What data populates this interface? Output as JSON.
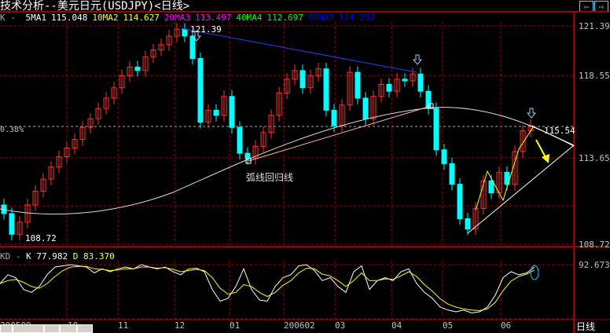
{
  "window": {
    "title": "技术分析--美元日元(USDJPY)<日线>",
    "nav_left_icon": "arrow-left-icon",
    "nav_right_icon": "arrow-right-icon"
  },
  "ma_row": {
    "prefix": "K -",
    "items": [
      {
        "label": "5MA1",
        "value": "115.048",
        "color": "#ffffff"
      },
      {
        "label": "10MA2",
        "value": "114.627",
        "color": "#ffff00"
      },
      {
        "label": "20MA3",
        "value": "113.497",
        "color": "#ff00ff"
      },
      {
        "label": "40MA4",
        "value": "112.697",
        "color": "#00ff00"
      },
      {
        "label": "60MA5",
        "value": "114.292",
        "color": "#0000ff"
      }
    ]
  },
  "price_axis": [
    "121.39",
    "118.55",
    "115.54",
    "113.65",
    "108.72"
  ],
  "left_readout": "0.38%",
  "annotations": {
    "high_label": "121.39",
    "low_label": "108.72",
    "last_label": "115.54",
    "curve_label": "弧线回归线"
  },
  "kd_row": {
    "prefix": "KD -",
    "k_label": "K",
    "k_value": "77.982",
    "d_label": "D",
    "d_value": "83.370",
    "axis_value": "92.673"
  },
  "x_axis": {
    "labels": [
      "200509",
      "10",
      "11",
      "12",
      "01",
      "200602",
      "03",
      "04",
      "05",
      "06"
    ],
    "period": "日线"
  },
  "colors": {
    "up": "#ff3030",
    "down": "#00ffff",
    "grid": "#a00000",
    "k": "#ffffff",
    "d": "#ffff00"
  },
  "chart_data": [
    {
      "type": "candlestick",
      "ylim": [
        108.72,
        121.39
      ],
      "closes": [
        110.5,
        109.3,
        110,
        111,
        111.8,
        112.5,
        113.2,
        113.8,
        114.3,
        114.8,
        115.5,
        116,
        116.6,
        117.2,
        117.8,
        118.5,
        119,
        118.8,
        119.6,
        120,
        120.3,
        120.8,
        121.2,
        120.8,
        119.5,
        115.8,
        116.5,
        116.2,
        117.3,
        115.5,
        114,
        113.7,
        114.4,
        115.2,
        116.2,
        117.5,
        118.3,
        118.8,
        117.8,
        118.5,
        118.9,
        116.5,
        115.6,
        116.8,
        118.7,
        117.2,
        116,
        117.3,
        118,
        117.6,
        118.3,
        118.2,
        118.6,
        117.6,
        116.6,
        114.2,
        113.4,
        112.2,
        110.2,
        109.6,
        110.8,
        112.4,
        111.7,
        112.9,
        112.2,
        114.1,
        115.3,
        115.6
      ]
    },
    {
      "type": "line",
      "ylim": [
        0,
        100
      ],
      "series": [
        {
          "name": "K",
          "values": [
            60,
            75,
            70,
            50,
            45,
            55,
            75,
            88,
            90,
            92,
            90,
            88,
            78,
            85,
            80,
            85,
            88,
            85,
            92,
            88,
            85,
            88,
            80,
            75,
            85,
            86,
            80,
            50,
            30,
            35,
            55,
            85,
            50,
            32,
            30,
            55,
            70,
            75,
            90,
            92,
            82,
            65,
            70,
            55,
            45,
            80,
            90,
            50,
            65,
            70,
            65,
            80,
            85,
            60,
            45,
            35,
            20,
            15,
            12,
            15,
            10,
            12,
            20,
            40,
            70,
            80,
            75,
            78,
            88
          ]
        },
        {
          "name": "D",
          "values": [
            60,
            65,
            67,
            62,
            55,
            52,
            60,
            72,
            82,
            88,
            89,
            89,
            85,
            84,
            82,
            83,
            85,
            85,
            88,
            88,
            86,
            87,
            84,
            80,
            82,
            84,
            82,
            70,
            52,
            42,
            45,
            58,
            55,
            45,
            38,
            45,
            57,
            65,
            78,
            86,
            85,
            76,
            73,
            65,
            55,
            65,
            78,
            65,
            65,
            68,
            67,
            73,
            80,
            72,
            58,
            47,
            34,
            25,
            20,
            17,
            15,
            14,
            17,
            28,
            48,
            64,
            72,
            76,
            83
          ]
        }
      ]
    }
  ]
}
